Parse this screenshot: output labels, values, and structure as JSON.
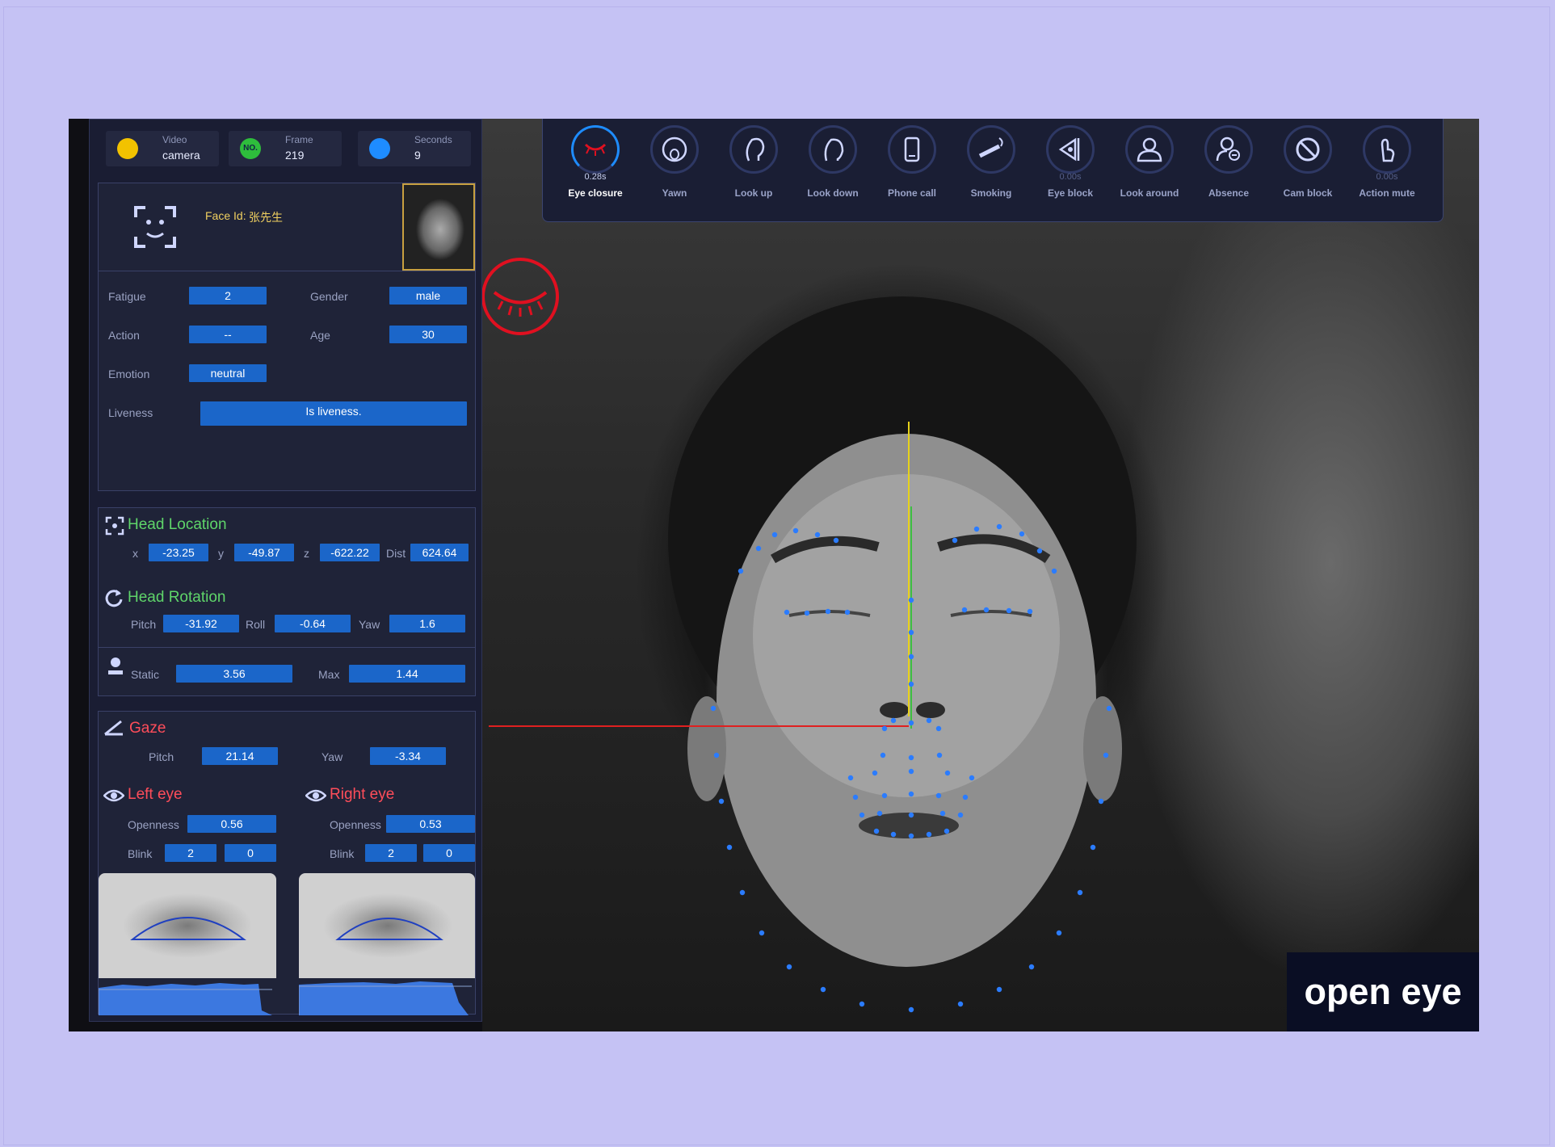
{
  "stats": {
    "video": {
      "label": "Video",
      "value": "camera"
    },
    "frame": {
      "label": "Frame",
      "value": "219"
    },
    "seconds": {
      "label": "Seconds",
      "value": "9"
    },
    "no_badge": "NO."
  },
  "face": {
    "id_label": "Face Id:",
    "id_value": "张先生"
  },
  "attributes": {
    "fatigue": {
      "label": "Fatigue",
      "value": "2"
    },
    "gender": {
      "label": "Gender",
      "value": "male"
    },
    "action": {
      "label": "Action",
      "value": "--"
    },
    "age": {
      "label": "Age",
      "value": "30"
    },
    "emotion": {
      "label": "Emotion",
      "value": "neutral"
    },
    "liveness": {
      "label": "Liveness",
      "value": "Is liveness."
    }
  },
  "head_location": {
    "title": "Head Location",
    "x": {
      "label": "x",
      "value": "-23.25"
    },
    "y": {
      "label": "y",
      "value": "-49.87"
    },
    "z": {
      "label": "z",
      "value": "-622.22"
    },
    "dist": {
      "label": "Dist",
      "value": "624.64"
    }
  },
  "head_rotation": {
    "title": "Head Rotation",
    "pitch": {
      "label": "Pitch",
      "value": "-31.92"
    },
    "roll": {
      "label": "Roll",
      "value": "-0.64"
    },
    "yaw": {
      "label": "Yaw",
      "value": "1.6"
    }
  },
  "motion": {
    "static": {
      "label": "Static",
      "value": "3.56"
    },
    "max": {
      "label": "Max",
      "value": "1.44"
    }
  },
  "gaze": {
    "title": "Gaze",
    "pitch": {
      "label": "Pitch",
      "value": "21.14"
    },
    "yaw": {
      "label": "Yaw",
      "value": "-3.34"
    }
  },
  "left_eye": {
    "title": "Left eye",
    "openness": {
      "label": "Openness",
      "value": "0.56"
    },
    "blink": {
      "label": "Blink",
      "value1": "2",
      "value2": "0"
    }
  },
  "right_eye": {
    "title": "Right eye",
    "openness": {
      "label": "Openness",
      "value": "0.53"
    },
    "blink": {
      "label": "Blink",
      "value1": "2",
      "value2": "0"
    }
  },
  "detections": [
    {
      "label": "Eye closure",
      "time": "0.28s",
      "icon": "eye-closure-icon",
      "active": true
    },
    {
      "label": "Yawn",
      "time": "",
      "icon": "yawn-icon",
      "active": false
    },
    {
      "label": "Look up",
      "time": "",
      "icon": "look-up-icon",
      "active": false
    },
    {
      "label": "Look down",
      "time": "",
      "icon": "look-down-icon",
      "active": false
    },
    {
      "label": "Phone call",
      "time": "",
      "icon": "phone-icon",
      "active": false
    },
    {
      "label": "Smoking",
      "time": "",
      "icon": "cigarette-icon",
      "active": false
    },
    {
      "label": "Eye block",
      "time": "0.00s",
      "icon": "eye-block-icon",
      "active": false
    },
    {
      "label": "Look around",
      "time": "",
      "icon": "look-around-icon",
      "active": false
    },
    {
      "label": "Absence",
      "time": "",
      "icon": "absence-icon",
      "active": false
    },
    {
      "label": "Cam block",
      "time": "",
      "icon": "cam-block-icon",
      "active": false
    },
    {
      "label": "Action mute",
      "time": "0.00s",
      "icon": "hand-finger-icon",
      "active": false
    }
  ],
  "brand": {
    "text": "open eye"
  },
  "colors": {
    "accent": "#1e8cff",
    "value_bg": "#1b66c9",
    "alert": "#e01020",
    "section_green": "#5fd56a",
    "section_red": "#ff4d5a"
  }
}
